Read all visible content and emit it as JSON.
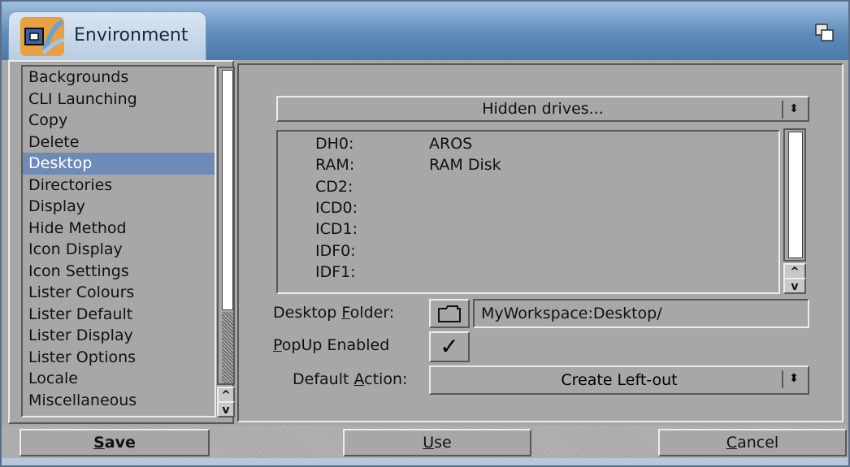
{
  "window": {
    "title": "Environment"
  },
  "categories": {
    "items": [
      "Backgrounds",
      "CLI Launching",
      "Copy",
      "Delete",
      "Desktop",
      "Directories",
      "Display",
      "Hide Method",
      "Icon Display",
      "Icon Settings",
      "Lister Colours",
      "Lister Default",
      "Lister Display",
      "Lister Options",
      "Locale",
      "Miscellaneous"
    ],
    "selected": "Desktop"
  },
  "desktop": {
    "hidden_drives_label": "Hidden drives...",
    "drives": [
      {
        "device": "DH0:",
        "name": "AROS"
      },
      {
        "device": "RAM:",
        "name": "RAM Disk"
      },
      {
        "device": "CD2:",
        "name": ""
      },
      {
        "device": "ICD0:",
        "name": ""
      },
      {
        "device": "ICD1:",
        "name": ""
      },
      {
        "device": "IDF0:",
        "name": ""
      },
      {
        "device": "IDF1:",
        "name": ""
      }
    ],
    "folder_label_pre": "Desktop ",
    "folder_label_key": "F",
    "folder_label_post": "older:",
    "folder_value": "MyWorkspace:Desktop/",
    "popup_label_key": "P",
    "popup_label_post": "opUp Enabled",
    "popup_checked": true,
    "action_label_pre": "Default ",
    "action_label_key": "A",
    "action_label_post": "ction:",
    "action_value": "Create Left-out"
  },
  "buttons": {
    "save_key": "S",
    "save_rest": "ave",
    "use_key": "U",
    "use_rest": "se",
    "cancel_key": "C",
    "cancel_rest": "ancel"
  }
}
